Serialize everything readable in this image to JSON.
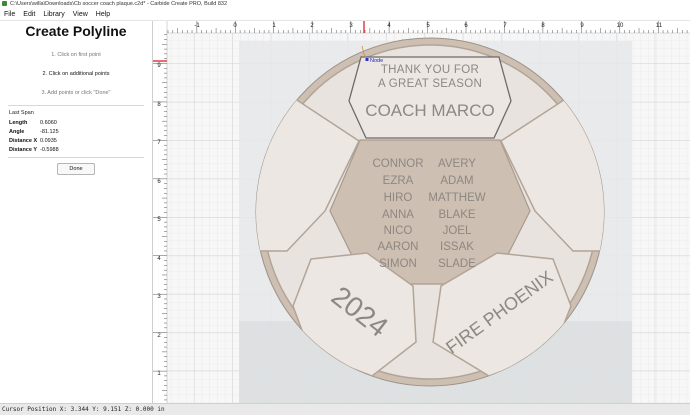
{
  "window": {
    "title": "C:\\Users\\willa\\Downloads\\Cb soccer coach plaque.c2d* - Carbide Create PRO, Build 832"
  },
  "menu": {
    "items": [
      "File",
      "Edit",
      "Library",
      "View",
      "Help"
    ]
  },
  "panel": {
    "title": "Create Polyline",
    "steps": [
      "1. Click on first point",
      "2. Click on additional points",
      "3. Add points or click \"Done\""
    ],
    "active_step": 2,
    "section_label": "Last Span",
    "fields": [
      {
        "label": "Length",
        "value": "0.6060"
      },
      {
        "label": "Angle",
        "value": "-81.125"
      },
      {
        "label": "Distance X",
        "value": "0.0935"
      },
      {
        "label": "Distance Y",
        "value": "-0.5988"
      }
    ],
    "done_label": "Done"
  },
  "ruler": {
    "x_labels": [
      "-1",
      "0",
      "1",
      "2",
      "3",
      "4",
      "5",
      "6",
      "7",
      "8",
      "9",
      "10",
      "11"
    ],
    "y_labels": [
      "9",
      "8",
      "7",
      "6",
      "5",
      "4",
      "3",
      "2",
      "1"
    ]
  },
  "design": {
    "node_label": "Node",
    "plate_line1": "THANK YOU FOR",
    "plate_line2": "A GREAT SEASON",
    "coach": "COACH MARCO",
    "names_left": [
      "CONNOR",
      "EZRA",
      "HIRO",
      "ANNA",
      "NICO",
      "AARON",
      "SIMON"
    ],
    "names_right": [
      "AVERY",
      "ADAM",
      "MATTHEW",
      "BLAKE",
      "JOEL",
      "ISSAK",
      "SLADE"
    ],
    "year": "2024",
    "team": "FIRE PHOENIX"
  },
  "status": {
    "cursor": "Cursor Position X: 3.344 Y: 9.151 Z: 0.000 in"
  },
  "colors": {
    "wood": "#cdbfb1",
    "wood_dark": "#b9a899",
    "panel_face": "#ece7e2",
    "engrave": "#8e8782",
    "grid_line": "#d7d7d7",
    "guide_red": "#e03030"
  }
}
